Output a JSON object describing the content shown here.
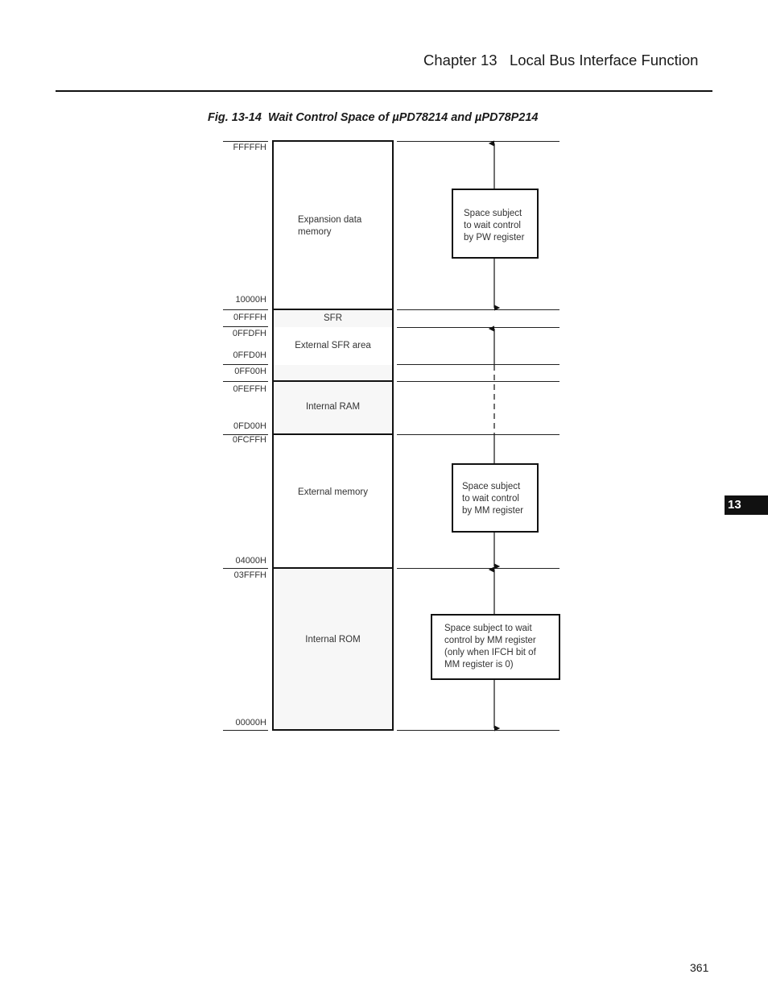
{
  "header": {
    "chapter_title": "Chapter 13   Local Bus Interface Function"
  },
  "figure": {
    "caption": "Fig. 13-14  Wait Control Space of µPD78214 and µPD78P214"
  },
  "memory_map": {
    "addresses": {
      "top": "FFFFFH",
      "expansion_bottom": "10000H",
      "sfr_top": "0FFFFH",
      "ext_sfr_top": "0FFDFH",
      "ext_sfr_bottom": "0FFD0H",
      "ff00": "0FF00H",
      "ram_top": "0FEFFH",
      "ram_bottom": "0FD00H",
      "ext_mem_top": "0FCFFH",
      "ext_mem_bottom": "04000H",
      "rom_top": "03FFFH",
      "rom_bottom": "00000H"
    },
    "regions": {
      "expansion": "Expansion data\nmemory",
      "sfr": "SFR",
      "ext_sfr": "External SFR area",
      "internal_ram": "Internal RAM",
      "external_memory": "External memory",
      "internal_rom": "Internal ROM"
    }
  },
  "notes": {
    "pw": "Space subject\nto wait control\nby PW register",
    "mm": "Space subject\nto wait control\nby MM register",
    "mm_ifch": "Space subject to wait\ncontrol by MM register\n(only when IFCH bit of\nMM register is 0)"
  },
  "side_tab": {
    "label": "13"
  },
  "footer": {
    "page_number": "361"
  },
  "colors": {
    "ink": "#111111",
    "region_shade": "#f7f7f7",
    "tab_bg": "#111111"
  }
}
